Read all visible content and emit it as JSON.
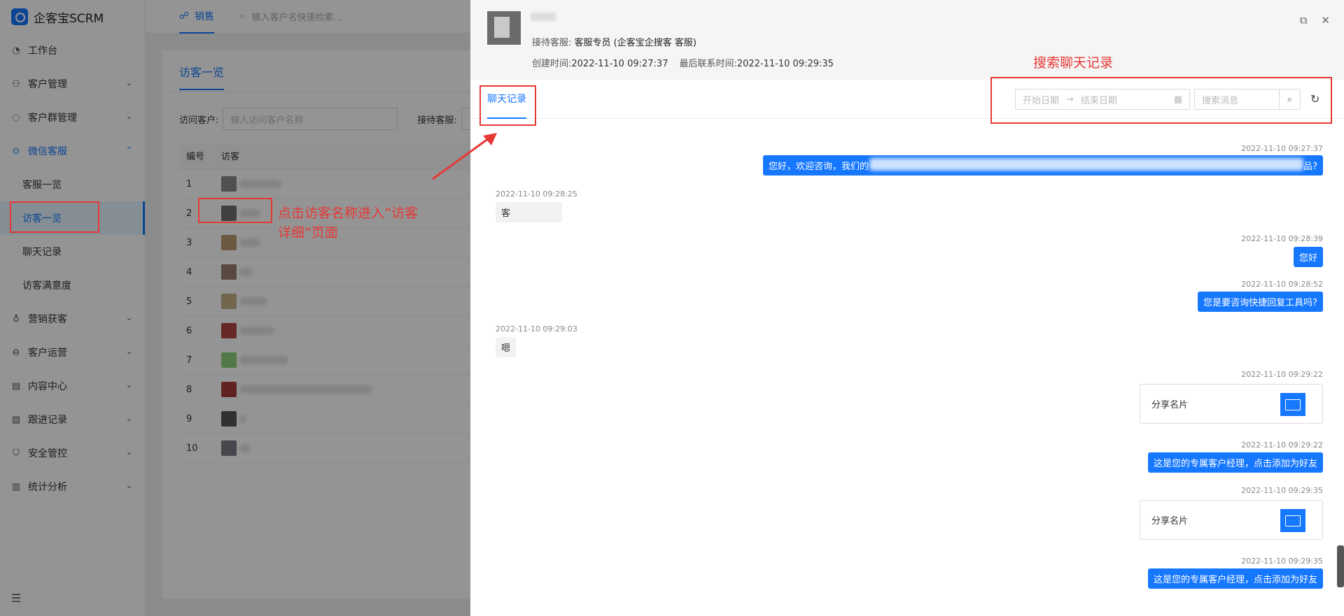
{
  "app": {
    "logo_text": "企客宝SCRM"
  },
  "sidebar": {
    "menu": [
      {
        "label": "工作台",
        "icon": "dashboard-icon"
      },
      {
        "label": "客户管理",
        "icon": "user-icon"
      },
      {
        "label": "客户群管理",
        "icon": "chat-group-icon"
      },
      {
        "label": "微信客服",
        "icon": "wechat-icon"
      },
      {
        "label": "营销获客",
        "icon": "bulb-icon"
      },
      {
        "label": "客户运营",
        "icon": "operation-icon"
      },
      {
        "label": "内容中心",
        "icon": "content-icon"
      },
      {
        "label": "跟进记录",
        "icon": "record-icon"
      },
      {
        "label": "安全管控",
        "icon": "shield-icon"
      },
      {
        "label": "统计分析",
        "icon": "chart-icon"
      }
    ],
    "wechat_sub": [
      "客服一览",
      "访客一览",
      "聊天记录",
      "访客满意度"
    ]
  },
  "topbar": {
    "tab_label": "销售",
    "search_placeholder": "输入客户名快速检索..."
  },
  "content": {
    "title": "访客一览",
    "filter_visitor_label": "访问客户:",
    "filter_visitor_placeholder": "输入访问客户名称",
    "filter_agent_label": "接待客服:",
    "table_headers": [
      "编号",
      "访客"
    ],
    "rows": [
      "1",
      "2",
      "3",
      "4",
      "5",
      "6",
      "7",
      "8",
      "9",
      "10"
    ]
  },
  "drawer": {
    "agent_label": "接待客服:",
    "agent_value": "客服专员 (企客宝企搜客 客服)",
    "created_label": "创建时间:",
    "created_value": "2022-11-10 09:27:37",
    "last_contact_label": "最后联系时间:",
    "last_contact_value": "2022-11-10 09:29:35",
    "tab_label": "聊天记录",
    "start_date_placeholder": "开始日期",
    "end_date_placeholder": "结束日期",
    "search_placeholder": "搜索消息"
  },
  "chat": {
    "m1_time": "2022-11-10 09:27:37",
    "m1_start": "您好，欢迎咨询，我们的",
    "m1_end": "品?",
    "m2_time": "2022-11-10 09:28:25",
    "m2_text": "客",
    "m3_time": "2022-11-10 09:28:39",
    "m3_text": "您好",
    "m4_time": "2022-11-10 09:28:52",
    "m4_text": "您是要咨询快捷回复工具吗?",
    "m5_time": "2022-11-10 09:29:03",
    "m5_text": "嗯",
    "m6_time": "2022-11-10 09:29:22",
    "m6_text": "分享名片",
    "m7_time": "2022-11-10 09:29:22",
    "m7_text": "这是您的专属客户经理，点击添加为好友",
    "m8_time": "2022-11-10 09:29:35",
    "m8_text": "分享名片",
    "m9_time": "2022-11-10 09:29:35",
    "m9_text": "这是您的专属客户经理，点击添加为好友"
  },
  "annotations": {
    "click_hint": "点击访客名称进入”访客\n详细“页面",
    "search_hint": "搜索聊天记录"
  },
  "colors": {
    "accent": "#1677ff",
    "annotation": "#e53935"
  }
}
